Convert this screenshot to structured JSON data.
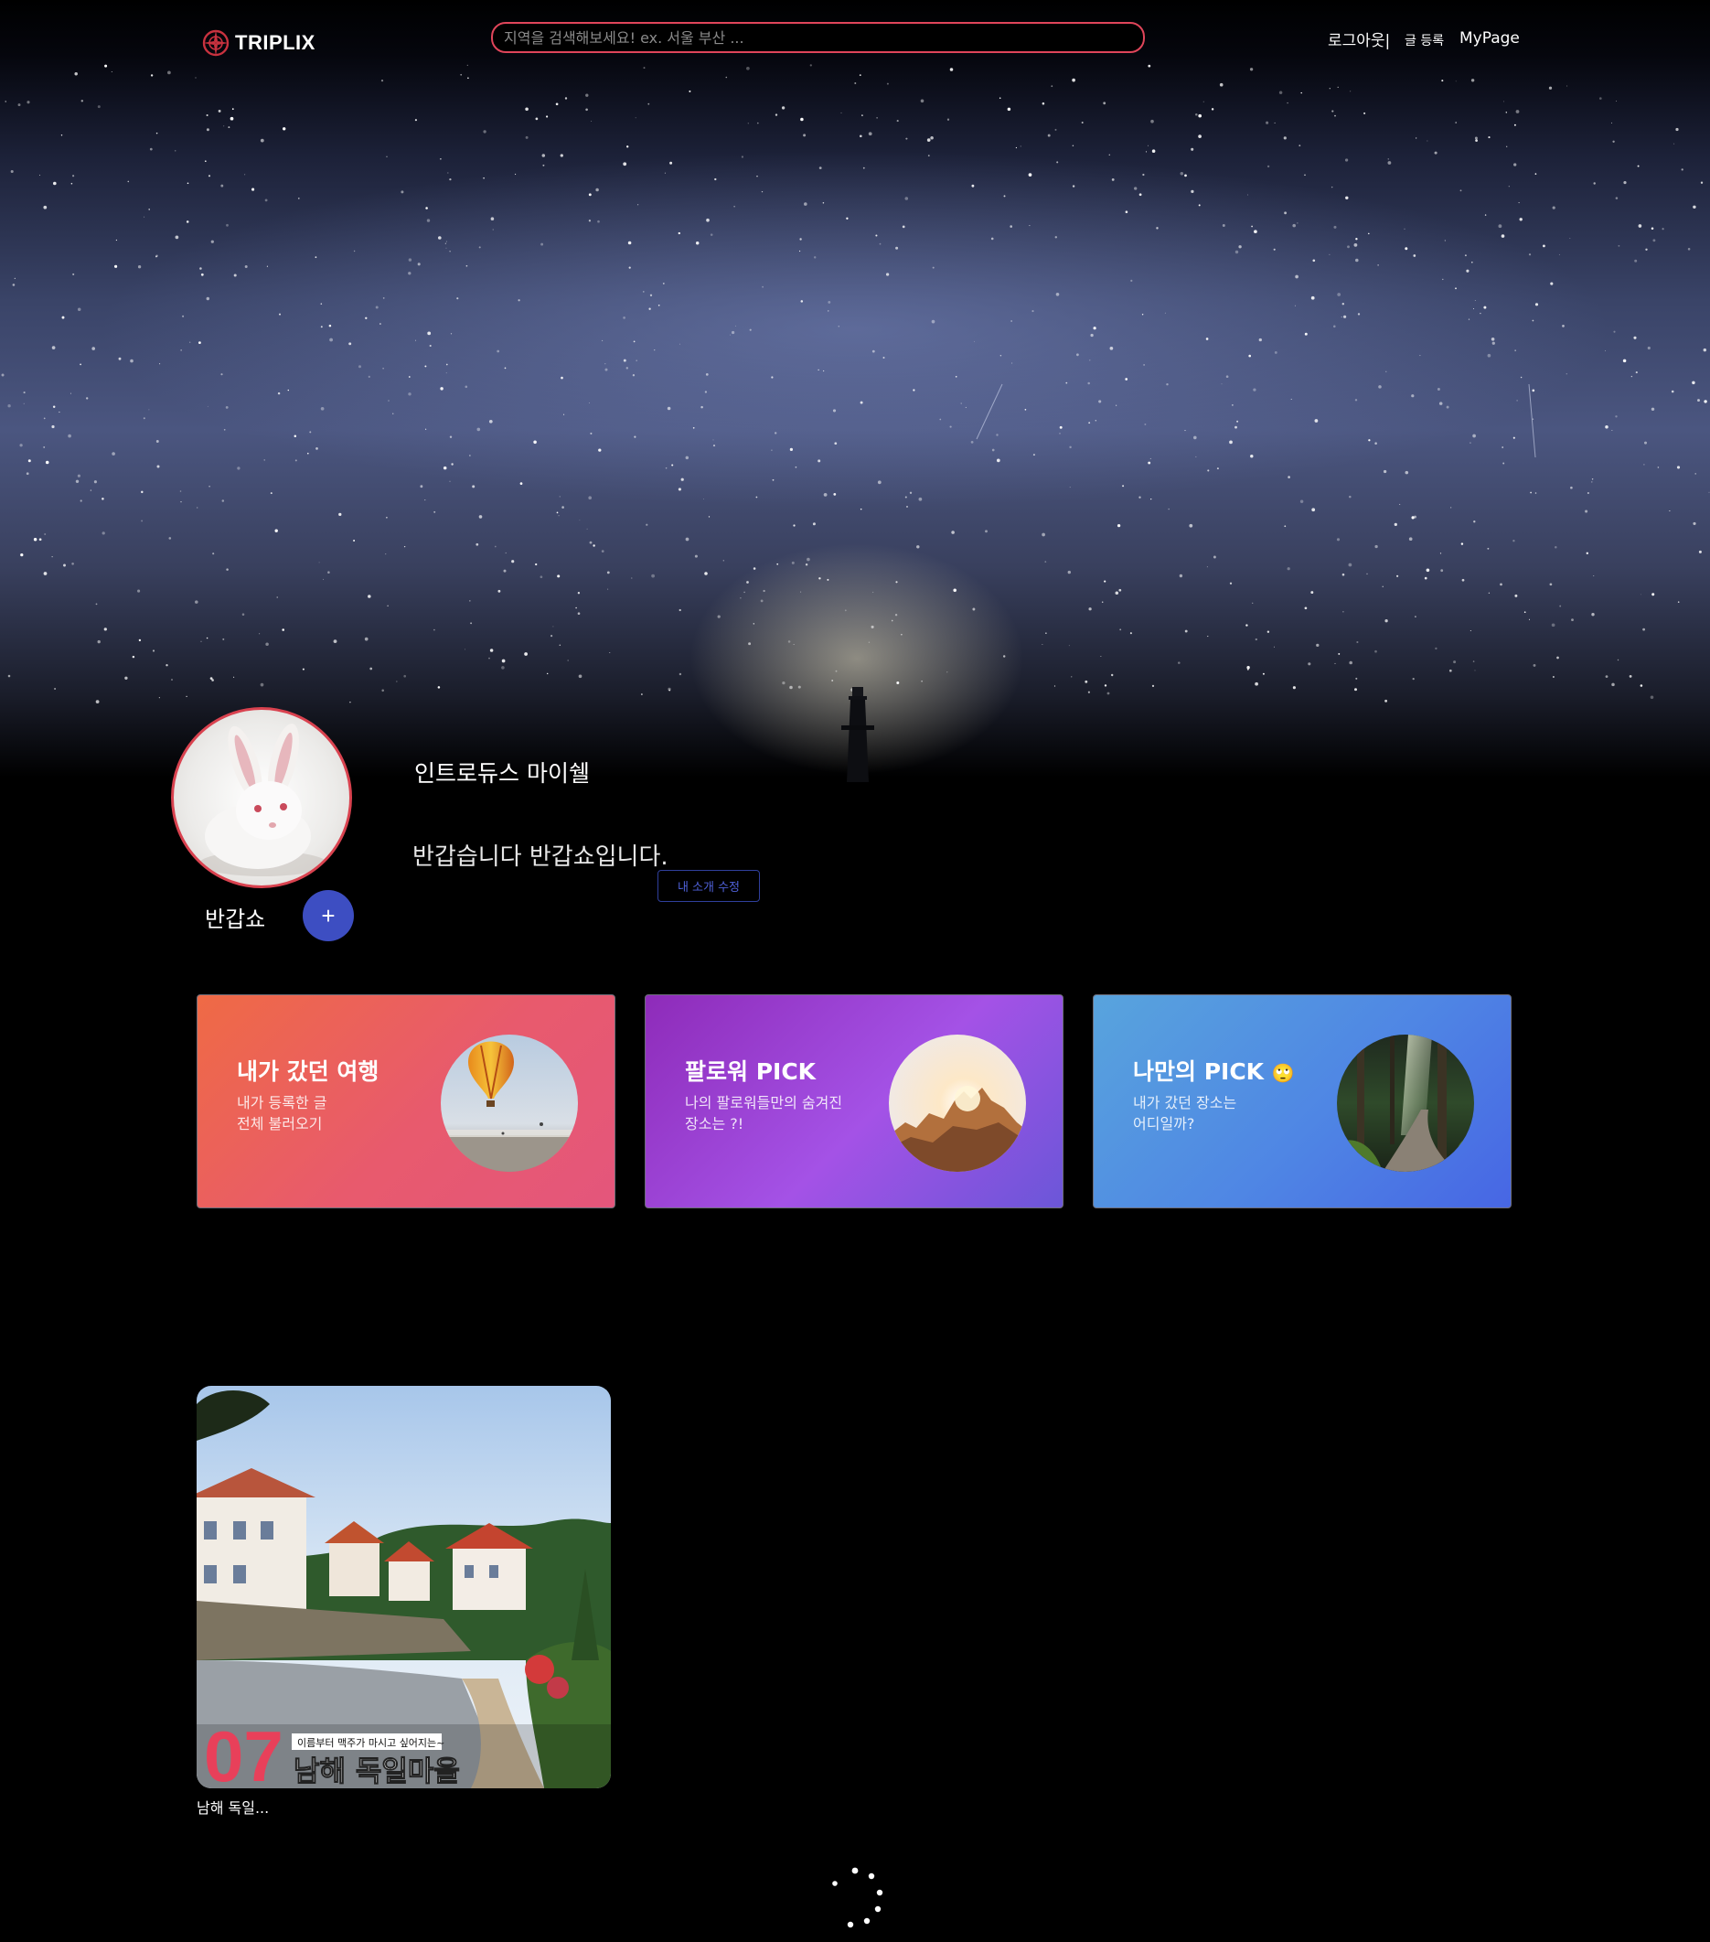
{
  "header": {
    "logo_text": "TRIPLIX",
    "search_placeholder": "지역을 검색해보세요! ex. 서울 부산 ...",
    "nav": {
      "logout": "로그아웃|",
      "write": "글 등록",
      "mypage": "MyPage"
    }
  },
  "profile": {
    "username": "반갑쇼",
    "follow_button": "+",
    "intro_title": "인트로듀스 마이쉘",
    "intro_text": "반갑습니다 반갑쇼입니다.",
    "edit_intro_button": "내 소개 수정"
  },
  "cards": [
    {
      "title": "내가 갔던 여행",
      "description": "내가 등록한 글\n전체 불러오기",
      "image": "hot-air-balloon"
    },
    {
      "title": "팔로워 PICK",
      "description": "나의 팔로워들만의 숨겨진\n장소는 ?!",
      "image": "sunlit-rocks"
    },
    {
      "title": "나만의 PICK",
      "title_emoji": "🙄",
      "description": "내가 갔던 장소는\n어디일까?",
      "image": "forest-path"
    }
  ],
  "posts": [
    {
      "caption": "남해 독일...",
      "thumb_number": "07",
      "thumb_subtitle": "이름부터 맥주가 마시고 싶어지는~",
      "thumb_title": "남해 독일마을"
    }
  ],
  "colors": {
    "accent": "#e0455a",
    "follow_button": "#3d4ec2",
    "background": "#000000"
  }
}
